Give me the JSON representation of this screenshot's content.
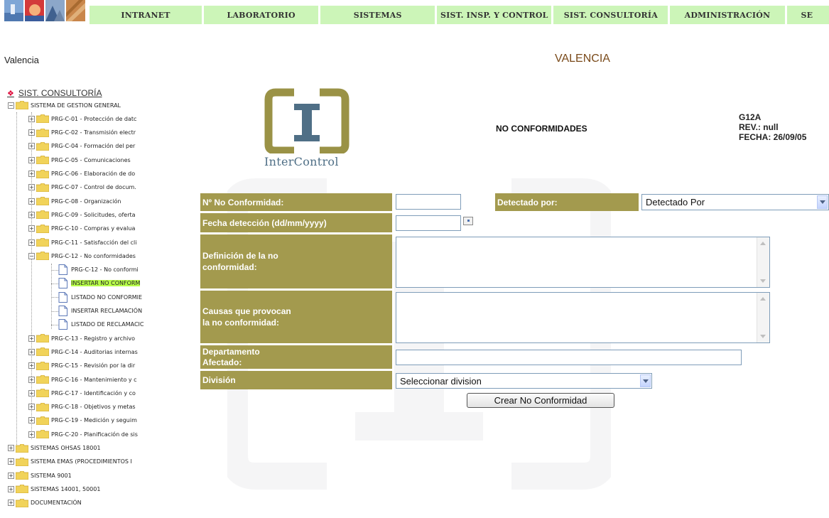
{
  "nav": {
    "items": [
      "INTRANET",
      "LABORATORIO",
      "SISTEMAS",
      "SIST. INSP. Y CONTROL",
      "SIST. CONSULTORÍA",
      "ADMINISTRACIÓN",
      "SE"
    ],
    "bg_color": "#ccf5b8"
  },
  "city_left": "Valencia",
  "city_right": "VALENCIA",
  "tree": {
    "root": "SIST. CONSULTORÍA",
    "group": "SISTEMA DE GESTION GENERAL",
    "items": [
      "PRG-C-01 - Protección de datc",
      "PRG-C-02 - Transmisión electr",
      "PRG-C-04 - Formación del per",
      "PRG-C-05 - Comunicaciones",
      "PRG-C-06 - Elaboración de do",
      "PRG-C-07 - Control de docum.",
      "PRG-C-08 - Organización",
      "PRG-C-09 - Solicitudes, oferta",
      "PRG-C-10 - Compras y evalua",
      "PRG-C-11 - Satisfacción del cli",
      "PRG-C-12 - No conformidades"
    ],
    "subitems": [
      "PRG-C-12 - No conformi",
      "INSERTAR NO CONFORM",
      "LISTADO NO CONFORMIE",
      "INSERTAR RECLAMACIÓN",
      "LISTADO DE RECLAMACIC"
    ],
    "items_after": [
      "PRG-C-13 - Registro y archivo",
      "PRG-C-14 - Auditorias internas",
      "PRG-C-15 - Revisión por la dir",
      "PRG-C-16 - Mantenimiento y c",
      "PRG-C-17 - Identificación y co",
      "PRG-C-18 - Objetivos y metas",
      "PRG-C-19 - Medición y seguim",
      "PRG-C-20 - Planificación de sis"
    ],
    "top_level": [
      "SISTEMAS OHSAS 18001",
      "SISTEMA EMAS (PROCEDIMIENTOS I",
      "SISTEMA 9001",
      "SISTEMAS 14001, 50001",
      "DOCUMENTACIÓN"
    ],
    "selected_color": "#b8ff4a"
  },
  "logo": {
    "text": "InterControl",
    "color": "#9a9246",
    "accent": "#4f6f86"
  },
  "doc": {
    "title": "NO CONFORMIDADES",
    "code": "G12A",
    "rev": "REV.: null",
    "fecha": "FECHA: 26/09/05"
  },
  "form": {
    "label_color": "#a39a4e",
    "n_label": "Nº No Conformidad:",
    "detectado_label": "Detectado por:",
    "detectado_value": "Detectado Por",
    "fecha_label": "Fecha detección (dd/mm/yyyy)",
    "definicion_l1": "Definición de la no",
    "definicion_l2": "conformidad:",
    "causas_l1": "Causas que provocan",
    "causas_l2": "la no conformidad:",
    "depto_l1": "Departamento",
    "depto_l2": "Afectado:",
    "division_label": "División",
    "division_value": "Seleccionar division",
    "submit": "Crear No Conformidad"
  }
}
